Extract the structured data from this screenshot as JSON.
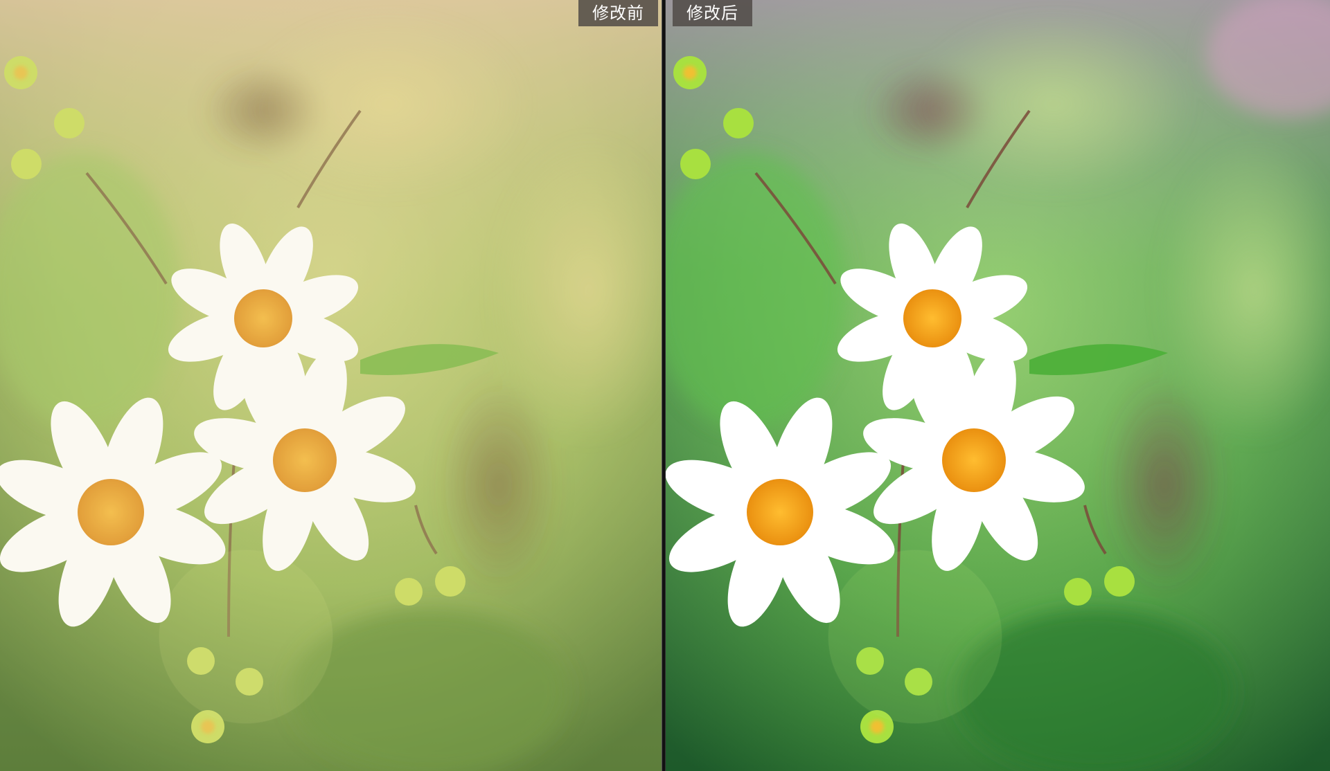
{
  "compare": {
    "before_label": "修改前",
    "after_label": "修改后"
  },
  "panes": [
    {
      "name": "before",
      "tone": "warm-faded"
    },
    {
      "name": "after",
      "tone": "vivid-green"
    }
  ],
  "colors": {
    "before_bg_top": "#d9c9a0",
    "before_bg_mid": "#a8c060",
    "before_bg_low": "#6f9a40",
    "after_bg_top": "#9a8aa0",
    "after_bg_mid": "#6fbf50",
    "after_bg_low": "#2e8a3a",
    "petal": "#ffffff",
    "center": "#f2a52a",
    "label_bg": "#504a46"
  }
}
